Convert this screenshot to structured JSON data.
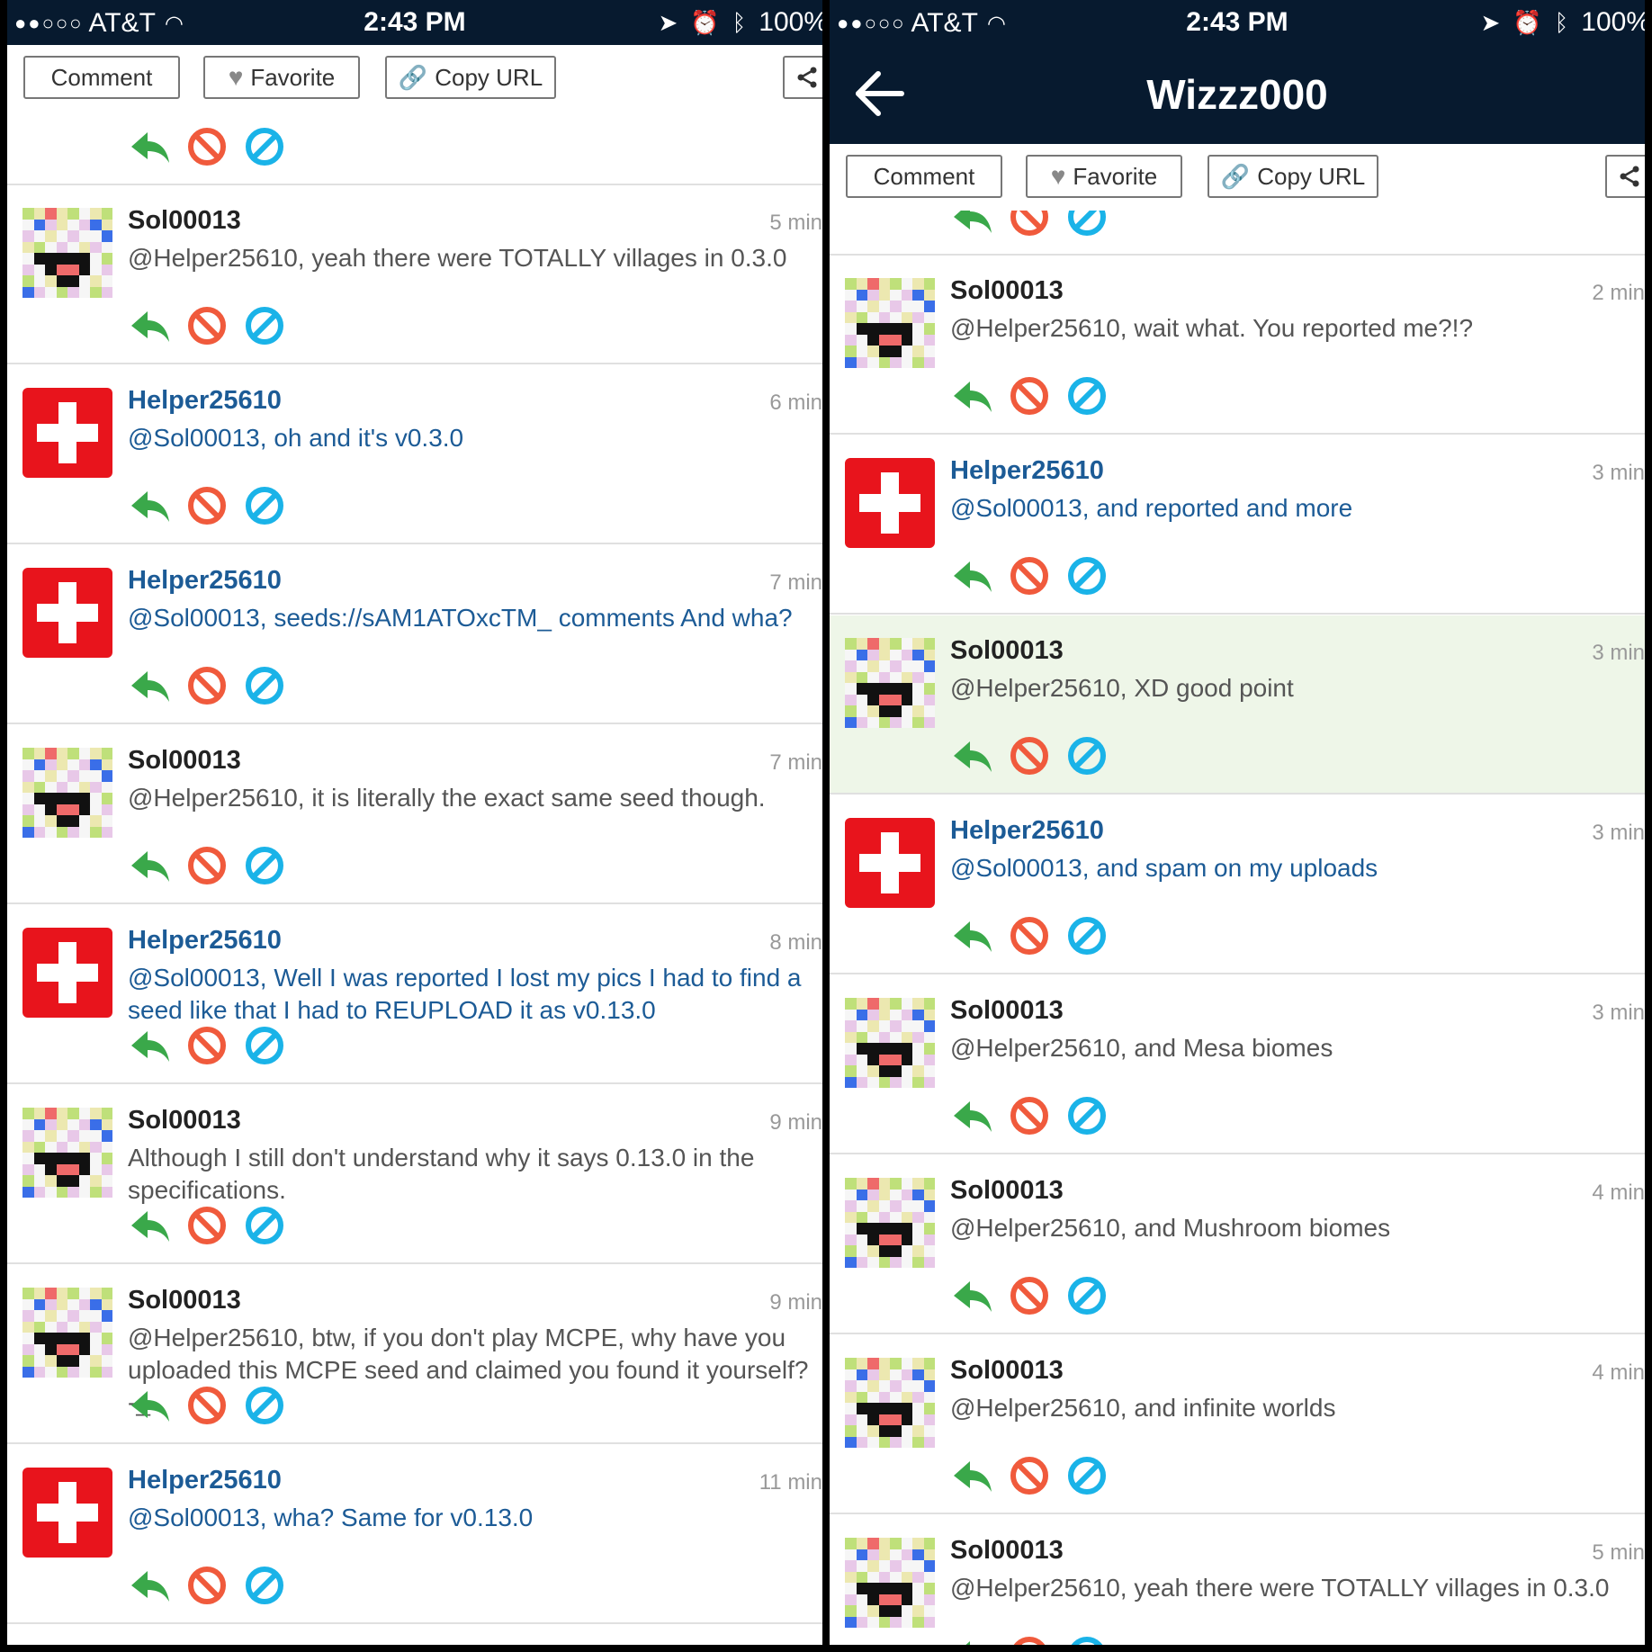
{
  "status": {
    "carrier": "AT&T",
    "time": "2:43 PM",
    "battery": "100%"
  },
  "toolbar": {
    "comment_label": "Comment",
    "favorite_label": "Favorite",
    "copy_url_label": "Copy URL"
  },
  "right_nav": {
    "title": "Wizzz000"
  },
  "left_comments": [
    {
      "user": "Sol00013",
      "time": "5 min",
      "text": "@Helper25610, yeah there were TOTALLY villages in 0.3.0",
      "kind": "sol"
    },
    {
      "user": "Helper25610",
      "time": "6 min",
      "text": "@Sol00013, oh and it's v0.3.0",
      "kind": "helper"
    },
    {
      "user": "Helper25610",
      "time": "7 min",
      "text": "@Sol00013, seeds://sAM1ATOxcTM_ comments And wha?",
      "kind": "helper"
    },
    {
      "user": "Sol00013",
      "time": "7 min",
      "text": "@Helper25610, it is literally the exact same seed though.",
      "kind": "sol"
    },
    {
      "user": "Helper25610",
      "time": "8 min",
      "text": "@Sol00013, Well I was reported I lost my pics I had to find a seed like that I had to REUPLOAD it as v0.13.0",
      "kind": "helper"
    },
    {
      "user": "Sol00013",
      "time": "9 min",
      "text": "Although I still don't understand why it says 0.13.0 in the specifications.",
      "kind": "sol"
    },
    {
      "user": "Sol00013",
      "time": "9 min",
      "text": "@Helper25610, btw, if you don't play MCPE, why have you uploaded this MCPE seed and claimed you found it yourself? -_-",
      "kind": "sol"
    },
    {
      "user": "Helper25610",
      "time": "11 min",
      "text": "@Sol00013, wha? Same for v0.13.0",
      "kind": "helper"
    }
  ],
  "right_comments": [
    {
      "user": "Sol00013",
      "time": "2 min",
      "text": "@Helper25610, wait what. You reported me?!?",
      "kind": "sol"
    },
    {
      "user": "Helper25610",
      "time": "3 min",
      "text": "@Sol00013, and reported and more",
      "kind": "helper"
    },
    {
      "user": "Sol00013",
      "time": "3 min",
      "text": "@Helper25610, XD good point",
      "kind": "sol",
      "highlight": true
    },
    {
      "user": "Helper25610",
      "time": "3 min",
      "text": "@Sol00013, and spam on my uploads",
      "kind": "helper"
    },
    {
      "user": "Sol00013",
      "time": "3 min",
      "text": "@Helper25610, and Mesa biomes",
      "kind": "sol"
    },
    {
      "user": "Sol00013",
      "time": "4 min",
      "text": "@Helper25610, and Mushroom biomes",
      "kind": "sol"
    },
    {
      "user": "Sol00013",
      "time": "4 min",
      "text": "@Helper25610, and infinite worlds",
      "kind": "sol"
    },
    {
      "user": "Sol00013",
      "time": "5 min",
      "text": "@Helper25610, yeah there were TOTALLY villages in 0.3.0",
      "kind": "sol"
    }
  ],
  "icons": {
    "reply": "reply-arrow-icon",
    "block": "block-icon",
    "report": "report-icon",
    "share": "share-icon",
    "heart": "heart-icon",
    "link": "link-icon",
    "back": "back-arrow-icon"
  },
  "colors": {
    "nav_bg": "#071a2f",
    "helper_blue": "#1c5b96",
    "reply_green": "#3aa84a",
    "block_red": "#f05a3c",
    "report_cyan": "#1ab3e8",
    "highlight_bg": "#eef6e8"
  }
}
